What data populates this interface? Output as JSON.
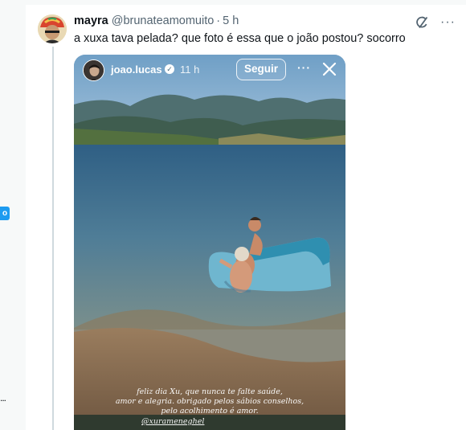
{
  "rail": {
    "badge": "o",
    "more": "..."
  },
  "tweet": {
    "display_name": "mayra",
    "handle": "@brunateamomuito",
    "separator": "·",
    "time": "5 h",
    "more": "···",
    "text": "a xuxa tava pelada? que foto é essa que o joão postou? socorro"
  },
  "story": {
    "username": "joao.lucas",
    "time": "11 h",
    "follow_label": "Seguir",
    "more": "···",
    "caption_line1": "feliz dia Xu, que nunca te falte saúde,",
    "caption_line2": "amor e alegria. obrigado pelos sábios conselhos,",
    "caption_line3": "pelo acolhimento é amor.",
    "caption_mention": "@xurameneghel"
  },
  "colors": {
    "accent": "#1d9bf0",
    "text": "#0f1419",
    "muted": "#536471"
  }
}
